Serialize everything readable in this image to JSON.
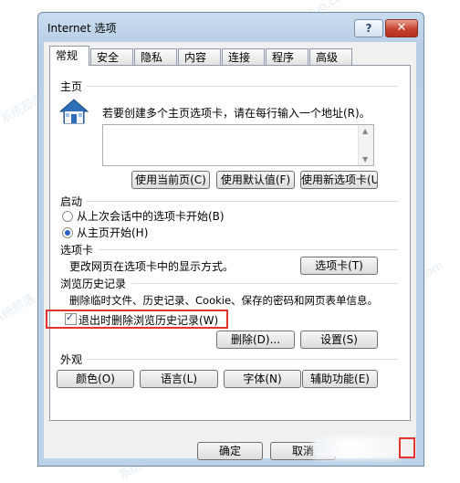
{
  "window": {
    "title": "Internet 选项",
    "help_label": "?",
    "close_label": "✕"
  },
  "tabs": [
    {
      "label": "常规",
      "active": true
    },
    {
      "label": "安全",
      "active": false
    },
    {
      "label": "隐私",
      "active": false
    },
    {
      "label": "内容",
      "active": false
    },
    {
      "label": "连接",
      "active": false
    },
    {
      "label": "程序",
      "active": false
    },
    {
      "label": "高级",
      "active": false
    }
  ],
  "home_page": {
    "section_title": "主页",
    "description": "若要创建多个主页选项卡，请在每行输入一个地址(R)。",
    "icon": "home-icon",
    "address_value": "",
    "buttons": {
      "use_current": "使用当前页(C)",
      "use_default": "使用默认值(F)",
      "use_new_tab": "使用新选项卡(U)"
    }
  },
  "startup": {
    "section_title": "启动",
    "options": [
      {
        "label": "从上次会话中的选项卡开始(B)",
        "selected": false
      },
      {
        "label": "从主页开始(H)",
        "selected": true
      }
    ]
  },
  "tab_section": {
    "section_title": "选项卡",
    "description": "更改网页在选项卡中的显示方式。",
    "button": "选项卡(T)"
  },
  "history": {
    "section_title": "浏览历史记录",
    "description": "删除临时文件、历史记录、Cookie、保存的密码和网页表单信息。",
    "checkbox_label": "退出时删除浏览历史记录(W)",
    "checkbox_checked": true,
    "delete_button": "删除(D)...",
    "settings_button": "设置(S)"
  },
  "appearance": {
    "section_title": "外观",
    "buttons": [
      "颜色(O)",
      "语言(L)",
      "字体(N)",
      "辅助功能(E)"
    ]
  },
  "footer": {
    "ok_button": "确定",
    "cancel_button": "取消"
  },
  "highlight_color": "#e3342f",
  "watermark": "系统部落 xitongbuluo.com"
}
